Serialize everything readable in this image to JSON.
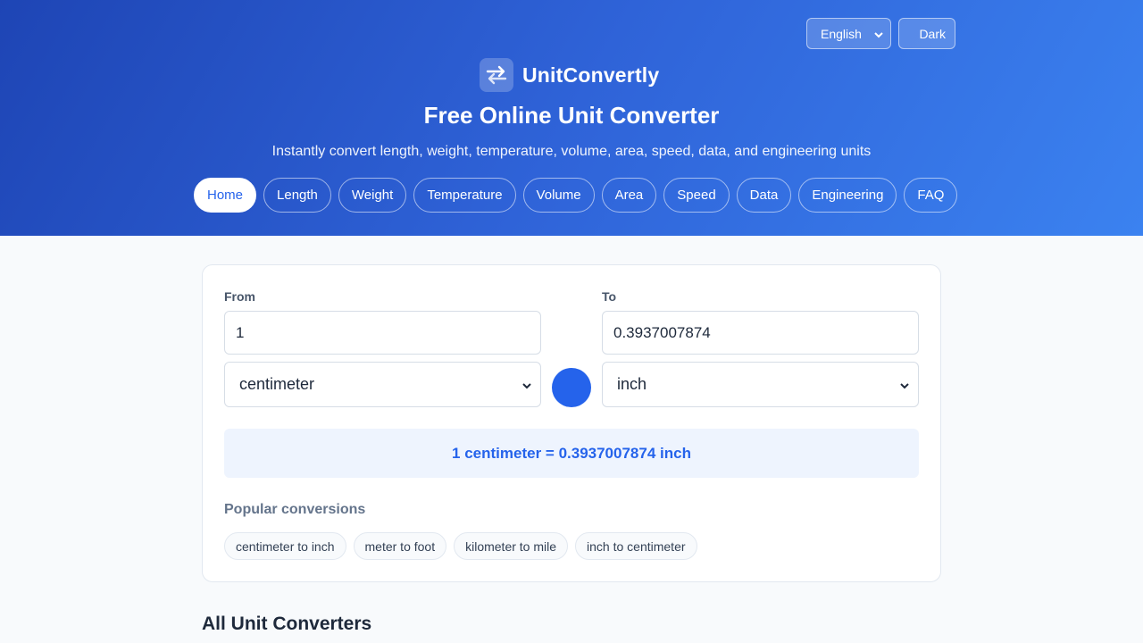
{
  "header": {
    "language": {
      "selected": "English"
    },
    "theme_toggle_label": "Dark",
    "brand_name": "UnitConvertly",
    "title": "Free Online Unit Converter",
    "subtitle": "Instantly convert length, weight, temperature, volume, area, speed, data, and engineering units",
    "nav": [
      {
        "label": "Home",
        "active": true
      },
      {
        "label": "Length",
        "active": false
      },
      {
        "label": "Weight",
        "active": false
      },
      {
        "label": "Temperature",
        "active": false
      },
      {
        "label": "Volume",
        "active": false
      },
      {
        "label": "Area",
        "active": false
      },
      {
        "label": "Speed",
        "active": false
      },
      {
        "label": "Data",
        "active": false
      },
      {
        "label": "Engineering",
        "active": false
      },
      {
        "label": "FAQ",
        "active": false
      }
    ]
  },
  "converter": {
    "from_label": "From",
    "to_label": "To",
    "from_value": "1",
    "to_value": "0.3937007874",
    "from_unit": "centimeter",
    "to_unit": "inch",
    "result_text": "1 centimeter = 0.3937007874 inch",
    "popular_title": "Popular conversions",
    "popular": [
      "centimeter to inch",
      "meter to foot",
      "kilometer to mile",
      "inch to centimeter"
    ]
  },
  "sections": {
    "all_converters_title": "All Unit Converters"
  },
  "colors": {
    "accent": "#2563eb",
    "header_start": "#1e45b5",
    "header_end": "#3b82f0",
    "result_bg": "#eef4fe"
  },
  "icons": {
    "logo": "swap-arrows-icon",
    "select_caret": "chevron-down-icon"
  }
}
